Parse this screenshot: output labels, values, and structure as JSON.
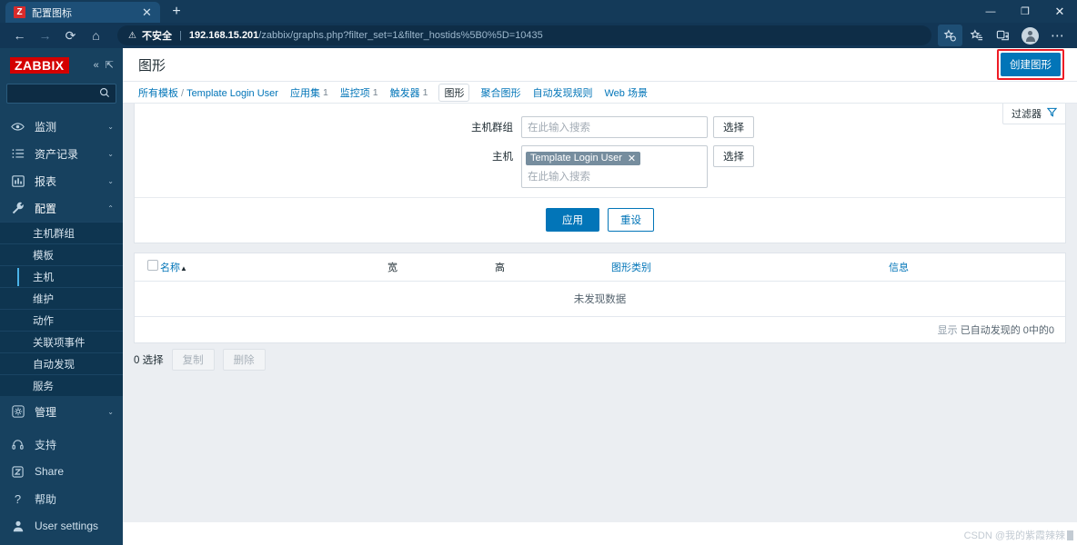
{
  "browser": {
    "tab": {
      "favicon_letter": "Z",
      "title": "配置图标",
      "close_icon": "✕"
    },
    "new_tab_icon": "+",
    "window_controls": {
      "minimize": "—",
      "restore": "❐",
      "close": "✕"
    },
    "nav": {
      "back": "←",
      "forward": "→",
      "reload": "⟳",
      "home": "⌂"
    },
    "omnibox": {
      "warning_icon": "⚠",
      "security_label": "不安全",
      "divider": "|",
      "url_host": "192.168.15.201",
      "url_path": "/zabbix/graphs.php?filter_set=1&filter_hostids%5B0%5D=10435"
    },
    "toolbar_icons": [
      "favorites-add-icon",
      "collections-icon",
      "split-screen-icon",
      "profile-avatar",
      "more-menu-icon"
    ],
    "more_menu": "⋯"
  },
  "sidebar": {
    "logo": "ZABBIX",
    "collapse_icon": "«",
    "expand_icon": "⇱",
    "search": {
      "value": "",
      "placeholder": "",
      "icon": "search-icon"
    },
    "sections": [
      {
        "icon": "eye-icon",
        "glyph": "◉",
        "label": "监测",
        "caret": "⌄",
        "open": false
      },
      {
        "icon": "list-icon",
        "glyph": "☰",
        "label": "资产记录",
        "caret": "⌄",
        "open": false
      },
      {
        "icon": "chart-icon",
        "glyph": "▥",
        "label": "报表",
        "caret": "⌄",
        "open": false
      },
      {
        "icon": "wrench-icon",
        "glyph": "🔧",
        "label": "配置",
        "caret": "⌃",
        "open": true
      }
    ],
    "config_subitems": [
      {
        "label": "主机群组",
        "active": false
      },
      {
        "label": "模板",
        "active": false
      },
      {
        "label": "主机",
        "active": true
      },
      {
        "label": "维护",
        "active": false
      },
      {
        "label": "动作",
        "active": false
      },
      {
        "label": "关联项事件",
        "active": false
      },
      {
        "label": "自动发现",
        "active": false
      },
      {
        "label": "服务",
        "active": false
      }
    ],
    "admin_section": {
      "icon": "gear-icon",
      "glyph": "⚙",
      "label": "管理",
      "caret": "⌄"
    },
    "bottom_items": [
      {
        "icon": "support-headset-icon",
        "glyph": "◡",
        "label": "支持"
      },
      {
        "icon": "share-z-icon",
        "glyph": "Z",
        "label": "Share"
      },
      {
        "icon": "help-question-icon",
        "glyph": "?",
        "label": "帮助"
      },
      {
        "icon": "user-icon",
        "glyph": "👤",
        "label": "User settings"
      }
    ]
  },
  "header": {
    "title": "图形",
    "create_button": "创建图形"
  },
  "breadcrumb": {
    "root": "所有模板",
    "separator": "/",
    "template": "Template Login User",
    "tabs": [
      {
        "label": "应用集",
        "count": "1",
        "active": false
      },
      {
        "label": "监控项",
        "count": "1",
        "active": false
      },
      {
        "label": "触发器",
        "count": "1",
        "active": false
      },
      {
        "label": "图形",
        "count": "",
        "active": true
      },
      {
        "label": "聚合图形",
        "count": "",
        "active": false
      },
      {
        "label": "自动发现规则",
        "count": "",
        "active": false
      },
      {
        "label": "Web 场景",
        "count": "",
        "active": false
      }
    ]
  },
  "filter": {
    "tab_label": "过滤器",
    "funnel_icon": "filter-funnel-icon",
    "host_group": {
      "label": "主机群组",
      "value": "",
      "placeholder": "在此输入搜索",
      "select_button": "选择"
    },
    "host": {
      "label": "主机",
      "chip": "Template Login User",
      "chip_remove": "✕",
      "placeholder": "在此输入搜索",
      "select_button": "选择"
    },
    "apply_button": "应用",
    "reset_button": "重设"
  },
  "table": {
    "columns": [
      {
        "key": "name",
        "label": "名称",
        "sorted": true,
        "sort_arrow": "▲"
      },
      {
        "key": "width",
        "label": "宽",
        "sorted": false
      },
      {
        "key": "height",
        "label": "高",
        "sorted": false
      },
      {
        "key": "graph_type",
        "label": "图形类别",
        "sorted": false
      },
      {
        "key": "info",
        "label": "信息",
        "sorted": false
      }
    ],
    "rows": [],
    "empty_message": "未发现数据",
    "footer_label": "显示",
    "footer_text": "已自动发现的 0中的0"
  },
  "selection_bar": {
    "count_text": "0 选择",
    "copy_button": "复制",
    "delete_button": "删除"
  },
  "watermark": {
    "text": "CSDN @我的紫霞辣辣"
  },
  "colors": {
    "zabbix_red": "#d40000",
    "accent_blue": "#0275b8",
    "sidebar_bg": "#17415f",
    "sidebar_sub_bg": "#0e3550",
    "browser_chrome": "#123655",
    "content_bg": "#ebeef2",
    "highlight_red": "#ee1c25",
    "chip_bg": "#768d9e"
  }
}
